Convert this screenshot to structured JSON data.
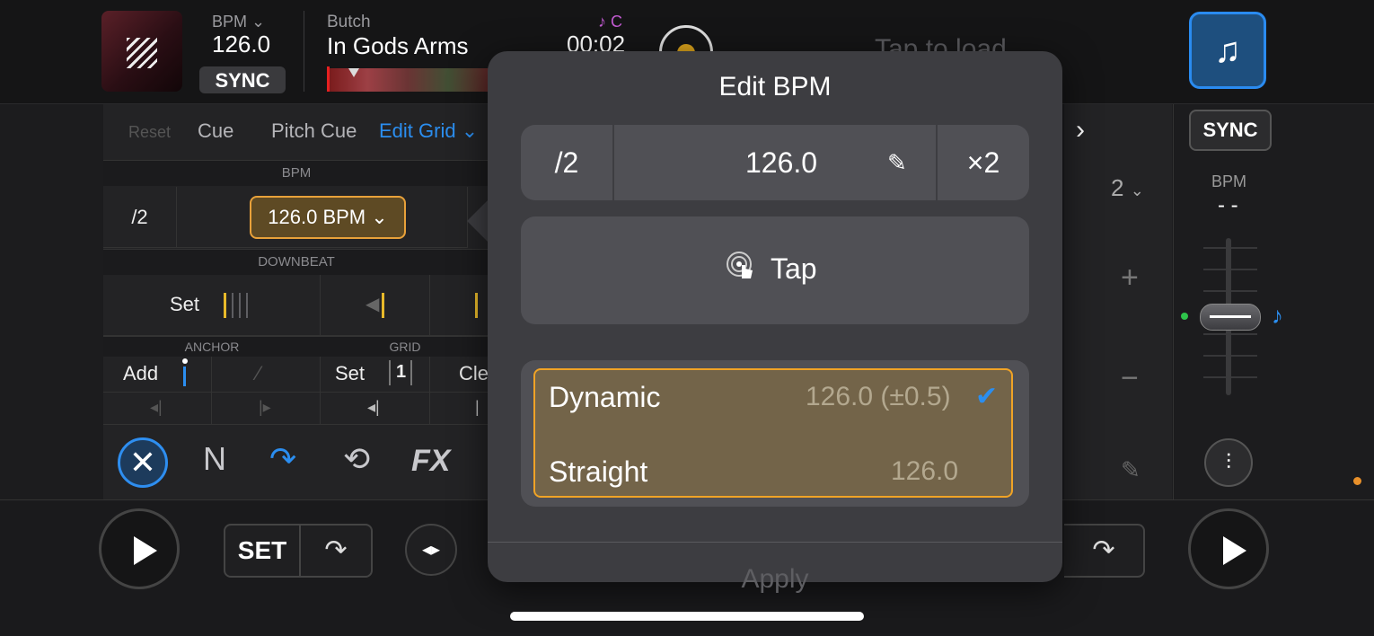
{
  "deck1": {
    "bpm_label": "BPM",
    "bpm_value": "126.0",
    "sync_label": "SYNC",
    "artist": "Butch",
    "title": "In Gods Arms",
    "key": "♪ C",
    "time": "00:02"
  },
  "deck2": {
    "placeholder": "Tap to load",
    "sync_label": "SYNC",
    "bpm_label": "BPM",
    "bpm_value": "- -",
    "beat_count": "2"
  },
  "grid_panel": {
    "tabs": [
      "Reset",
      "Cue",
      "Pitch Cue",
      "Edit Grid"
    ],
    "bpm_header": "BPM",
    "half_label": "/2",
    "bpm_pill": "126.0 BPM",
    "downbeat_header": "DOWNBEAT",
    "set_label": "Set",
    "anchor_header": "ANCHOR",
    "grid_header": "GRID",
    "add_label": "Add",
    "grid_set_label": "Set",
    "grid_set_num": "1",
    "clear_label": "Cle"
  },
  "toolbar": {
    "fx_label": "FX"
  },
  "transport": {
    "set_label": "SET"
  },
  "popover": {
    "title": "Edit BPM",
    "half": "/2",
    "value": "126.0",
    "double": "×2",
    "tap_label": "Tap",
    "modes": [
      {
        "name": "Dynamic",
        "value": "126.0 (±0.5)",
        "selected": true
      },
      {
        "name": "Straight",
        "value": "126.0",
        "selected": false
      }
    ],
    "apply_label": "Apply"
  },
  "colors": {
    "accent_blue": "#2b8ef0",
    "accent_orange": "#f0a326",
    "key_purple": "#c35bd3"
  }
}
